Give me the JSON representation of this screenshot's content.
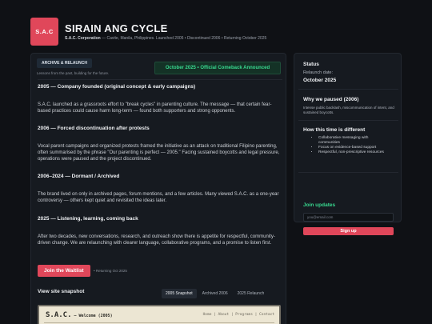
{
  "header": {
    "logo_text": "S.A.C",
    "title": "SIRAIN ANG CYCLE",
    "subtitle_org": "S.A.C. Corporation",
    "subtitle_rest": " — Cavite, Manila, Philippines. Launched 2005 • Discontinued 2006 • Returning October 2025"
  },
  "main": {
    "tag": "ARCHIVE & RELAUNCH",
    "tagline": "Lessons from the past, building for the future.",
    "announcement": "October 2025 • Official Comeback Announced",
    "timeline": [
      {
        "title": "2005 — Company founded (original concept & early campaigns)",
        "body": "S.A.C. launched as a grassroots effort to \"break cycles\" in parenting culture. The message — that certain fear-based practices could cause harm long-term — found both supporters and strong opponents."
      },
      {
        "title": "2006 — Forced discontinuation after protests",
        "body": "Vocal parent campaigns and organized protests framed the initiative as an attack on traditional Filipino parenting, often summarised by the phrase \"Our parenting is perfect — 2005.\" Facing sustained boycotts and legal pressure, operations were paused and the project discontinued."
      },
      {
        "title": "2006–2024 — Dormant / Archived",
        "body": "The brand lived on only in archived pages, forum mentions, and a few articles. Many viewed S.A.C. as a one-year controversy — others kept quiet and revisited the ideas later."
      },
      {
        "title": "2025 — Listening, learning, coming back",
        "body": "After two decades, new conversations, research, and outreach show there is appetite for respectful, community-driven change. We are relaunching with clearer language, collaborative programs, and a promise to listen first."
      }
    ],
    "cta_label": "Join the Waitlist",
    "cta_note": "• Returning Oct 2025",
    "snapshot_label": "View site snapshot",
    "snapshot_tabs": [
      "2005 Snapshot",
      "Archived 2006",
      "2025 Relaunch"
    ],
    "snapshot": {
      "brand": "S.A.C.",
      "brand_suffix": " — Welcome (2005)",
      "nav": "Home | About | Programs | Contact"
    }
  },
  "sidebar": {
    "status_heading": "Status",
    "relaunch_label": "Relaunch date:",
    "relaunch_value": "October 2025",
    "paused_heading": "Why we paused (2006)",
    "paused_text": "Intense public backlash, miscommunication of intent, and sustained boycotts.",
    "different_heading": "How this time is different",
    "different_items": [
      "Collaborative messaging with communities",
      "Focus on evidence-based support",
      "Respectful, non-prescriptive resources"
    ],
    "join_heading": "Join updates",
    "email_placeholder": "you@email.com",
    "signup_label": "Sign up"
  },
  "colors": {
    "accent": "#e0475a",
    "success": "#38d98f",
    "background": "#0f1115",
    "panel": "#161a20"
  }
}
